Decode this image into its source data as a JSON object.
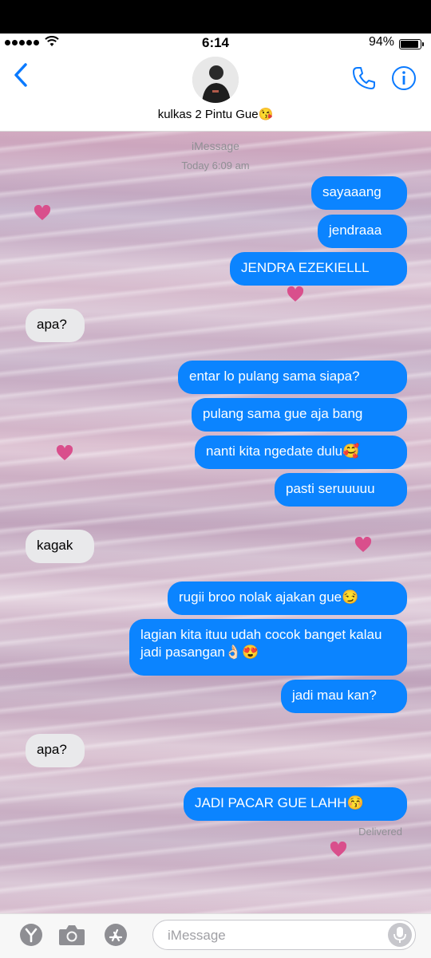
{
  "status": {
    "time": "6:14",
    "battery": "94%"
  },
  "header": {
    "contact_name": "kulkas 2 Pintu Gue😘"
  },
  "chat": {
    "service_label": "iMessage",
    "timestamp": "Today 6:09 am",
    "messages": [
      {
        "from": "me",
        "text": "sayaaang"
      },
      {
        "from": "me",
        "text": "jendraaa"
      },
      {
        "from": "me",
        "text": "JENDRA EZEKIELLL"
      },
      {
        "from": "them",
        "text": "apa?"
      },
      {
        "from": "me",
        "text": "entar lo pulang sama siapa?"
      },
      {
        "from": "me",
        "text": "pulang sama gue aja bang"
      },
      {
        "from": "me",
        "text": "nanti kita ngedate dulu🥰"
      },
      {
        "from": "me",
        "text": "pasti seruuuuu"
      },
      {
        "from": "them",
        "text": "kagak"
      },
      {
        "from": "me",
        "text": "rugii broo nolak ajakan gue😏"
      },
      {
        "from": "me",
        "text": "lagian kita ituu udah cocok banget kalau jadi pasangan👌🏻😍"
      },
      {
        "from": "me",
        "text": "jadi mau kan?"
      },
      {
        "from": "them",
        "text": "apa?"
      },
      {
        "from": "me",
        "text": "JADI PACAR GUE LAHH😚"
      }
    ],
    "delivered": "Delivered"
  },
  "input": {
    "placeholder": "iMessage"
  },
  "colors": {
    "sent_bubble": "#0b84ff",
    "received_bubble": "#e9e9eb",
    "accent": "#0a7aff"
  },
  "icons": [
    "back-chevron-icon",
    "phone-icon",
    "info-icon",
    "appstore-y-icon",
    "camera-icon",
    "apps-icon",
    "microphone-icon",
    "heart-icon"
  ]
}
